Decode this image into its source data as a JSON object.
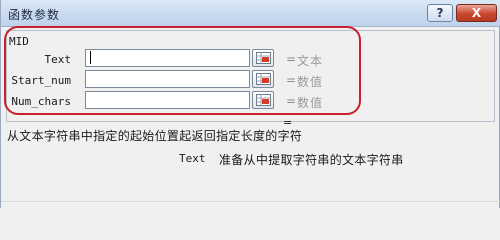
{
  "window": {
    "title": "函数参数",
    "help_label": "?",
    "close_label": "X"
  },
  "function": {
    "name": "MID",
    "args": [
      {
        "label": "Text",
        "value": "",
        "equals": "=",
        "hint": "文本"
      },
      {
        "label": "Start_num",
        "value": "",
        "equals": "=",
        "hint": "数值"
      },
      {
        "label": "Num_chars",
        "value": "",
        "equals": "=",
        "hint": "数值"
      }
    ]
  },
  "result": {
    "equals": "="
  },
  "description": {
    "function_text": "从文本字符串中指定的起始位置起返回指定长度的字符",
    "arg_name": "Text",
    "arg_text": "准备从中提取字符串的文本字符串"
  },
  "colors": {
    "highlight": "#c8202c",
    "titlebar": "#c9daef",
    "close_button": "#c8462e"
  },
  "icons": {
    "ref_button": "range-select-icon"
  }
}
